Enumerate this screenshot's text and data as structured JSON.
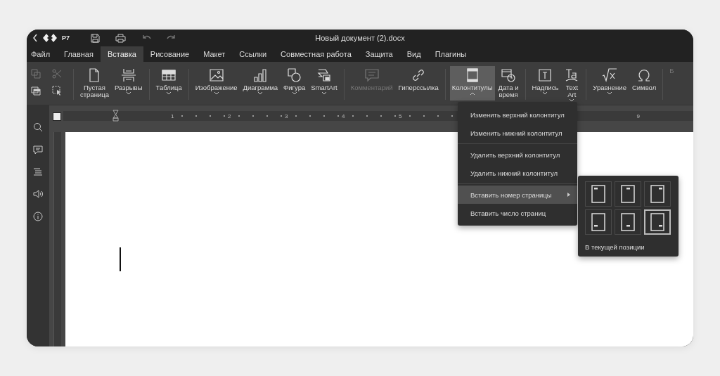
{
  "titlebar": {
    "app_name": "Р7",
    "title": "Новый документ (2).docx"
  },
  "tabs": [
    {
      "label": "Файл",
      "selected": false
    },
    {
      "label": "Главная",
      "selected": false
    },
    {
      "label": "Вставка",
      "selected": true
    },
    {
      "label": "Рисование",
      "selected": false
    },
    {
      "label": "Макет",
      "selected": false
    },
    {
      "label": "Ссылки",
      "selected": false
    },
    {
      "label": "Совместная работа",
      "selected": false
    },
    {
      "label": "Защита",
      "selected": false
    },
    {
      "label": "Вид",
      "selected": false
    },
    {
      "label": "Плагины",
      "selected": false
    }
  ],
  "ribbon": {
    "groups": [
      {
        "items": [
          {
            "label": "Пустая\nстраница",
            "disabled": false,
            "pressed": false,
            "has_menu": false
          },
          {
            "label": "Разрывы",
            "disabled": false,
            "pressed": false,
            "has_menu": true
          }
        ]
      },
      {
        "items": [
          {
            "label": "Таблица",
            "disabled": false,
            "pressed": false,
            "has_menu": true
          }
        ]
      },
      {
        "items": [
          {
            "label": "Изображение",
            "disabled": false,
            "pressed": false,
            "has_menu": true
          },
          {
            "label": "Диаграмма",
            "disabled": false,
            "pressed": false,
            "has_menu": true
          },
          {
            "label": "Фигура",
            "disabled": false,
            "pressed": false,
            "has_menu": true
          },
          {
            "label": "SmartArt",
            "disabled": false,
            "pressed": false,
            "has_menu": true
          }
        ]
      },
      {
        "items": [
          {
            "label": "Комментарий",
            "disabled": true,
            "pressed": false,
            "has_menu": false
          },
          {
            "label": "Гиперссылка",
            "disabled": false,
            "pressed": false,
            "has_menu": false
          }
        ]
      },
      {
        "items": [
          {
            "label": "Колонтитулы",
            "disabled": false,
            "pressed": true,
            "has_menu": true
          },
          {
            "label": "Дата и\nвремя",
            "disabled": false,
            "pressed": false,
            "has_menu": false
          }
        ]
      },
      {
        "items": [
          {
            "label": "Надпись",
            "disabled": false,
            "pressed": false,
            "has_menu": true
          },
          {
            "label": "Text\nArt",
            "disabled": false,
            "pressed": false,
            "has_menu": true
          }
        ]
      },
      {
        "items": [
          {
            "label": "Уравнение",
            "disabled": false,
            "pressed": false,
            "has_menu": true
          },
          {
            "label": "Символ",
            "disabled": false,
            "pressed": false,
            "has_menu": false
          }
        ]
      },
      {
        "items": [
          {
            "label": "Б",
            "disabled": true,
            "pressed": false,
            "has_menu": false
          }
        ]
      }
    ]
  },
  "ruler": {
    "numbers": [
      "1",
      "2",
      "3",
      "4",
      "5",
      "9"
    ]
  },
  "dropdown": {
    "groups": [
      {
        "items": [
          {
            "label": "Изменить верхний колонтитул",
            "selected": false,
            "submenu": false
          },
          {
            "label": "Изменить нижний колонтитул",
            "selected": false,
            "submenu": false
          }
        ]
      },
      {
        "items": [
          {
            "label": "Удалить верхний колонтитул",
            "selected": false,
            "submenu": false
          },
          {
            "label": "Удалить нижний колонтитул",
            "selected": false,
            "submenu": false
          }
        ]
      },
      {
        "items": [
          {
            "label": "Вставить номер страницы",
            "selected": true,
            "submenu": true
          },
          {
            "label": "Вставить число страниц",
            "selected": false,
            "submenu": false
          }
        ]
      }
    ]
  },
  "submenu": {
    "positions": [
      {
        "selected": false
      },
      {
        "selected": false
      },
      {
        "selected": false
      },
      {
        "selected": false
      },
      {
        "selected": false
      },
      {
        "selected": true
      }
    ],
    "current_position_label": "В текущей позиции"
  }
}
